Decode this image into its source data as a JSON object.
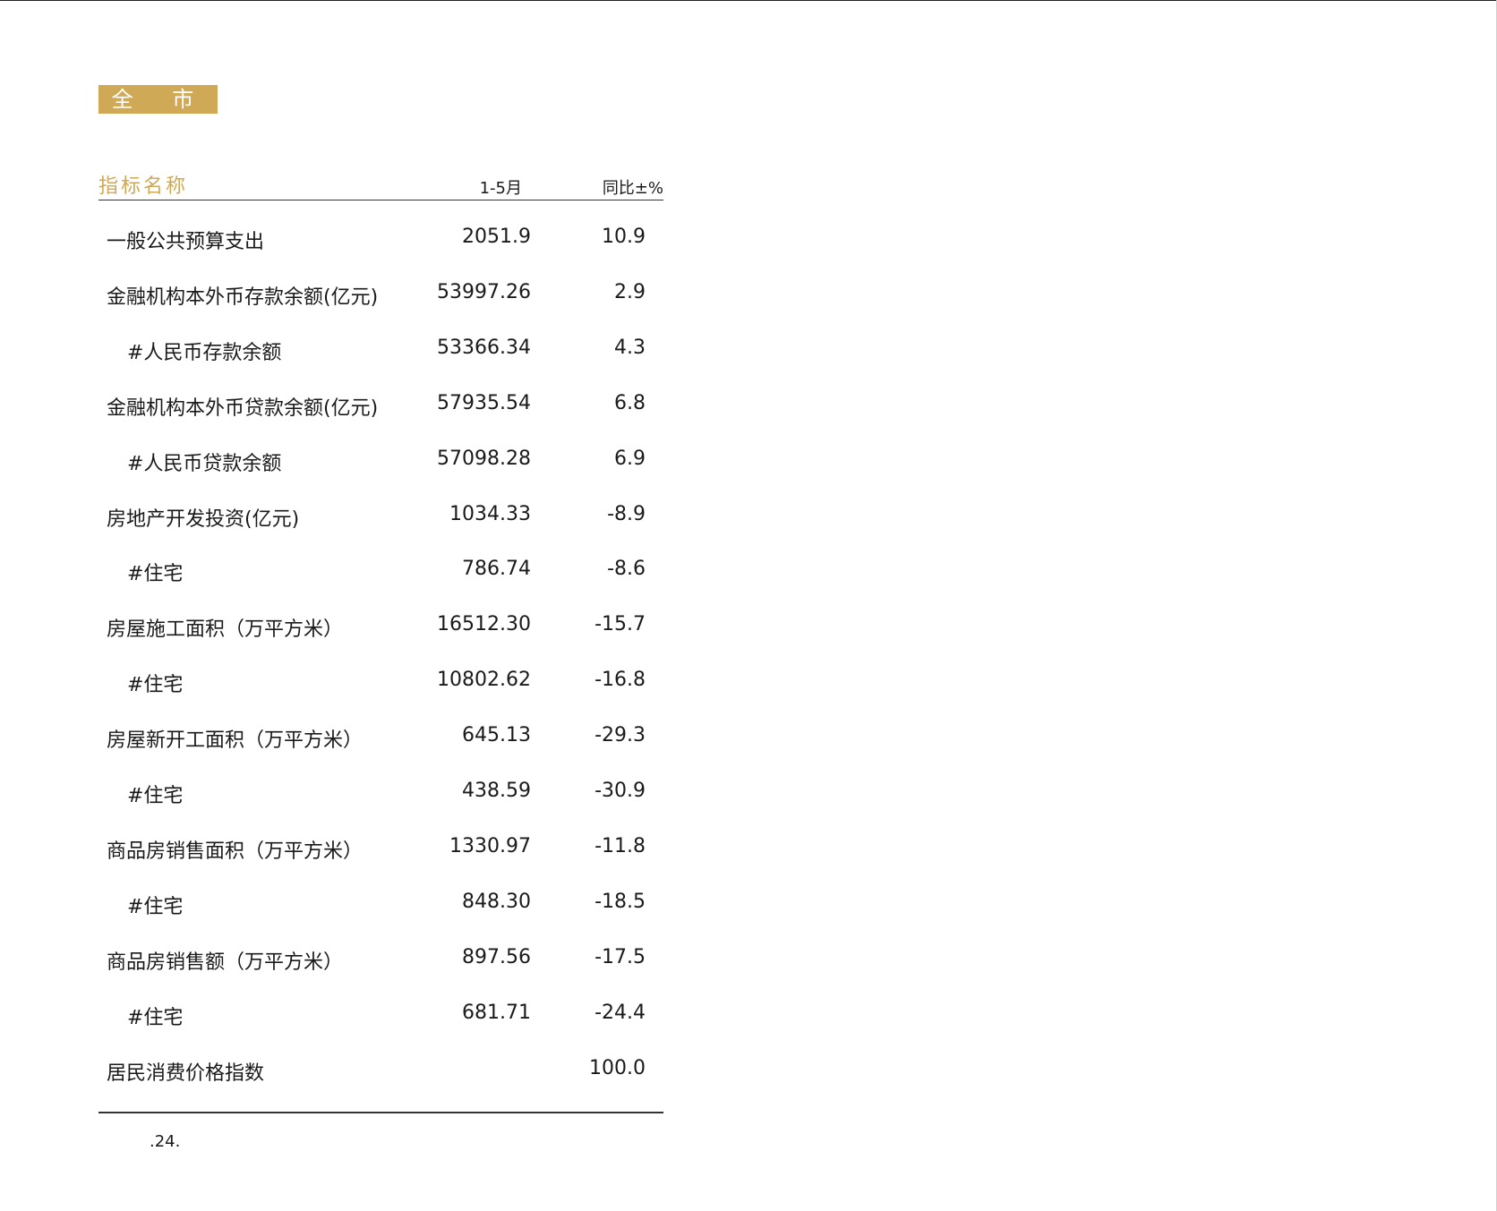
{
  "section_title": "全 市",
  "table": {
    "headers": {
      "name": "指标名称",
      "value": "1-5月",
      "yoy": "同比±%"
    },
    "rows": [
      {
        "name": "一般公共预算支出",
        "value": "2051.9",
        "yoy": "10.9",
        "sub": false
      },
      {
        "name": "金融机构本外币存款余额(亿元)",
        "value": "53997.26",
        "yoy": "2.9",
        "sub": false
      },
      {
        "name": "#人民币存款余额",
        "value": "53366.34",
        "yoy": "4.3",
        "sub": true
      },
      {
        "name": "金融机构本外币贷款余额(亿元)",
        "value": "57935.54",
        "yoy": "6.8",
        "sub": false
      },
      {
        "name": "#人民币贷款余额",
        "value": "57098.28",
        "yoy": "6.9",
        "sub": true
      },
      {
        "name": "房地产开发投资(亿元)",
        "value": "1034.33",
        "yoy": "-8.9",
        "sub": false
      },
      {
        "name": "#住宅",
        "value": "786.74",
        "yoy": "-8.6",
        "sub": true
      },
      {
        "name": "房屋施工面积（万平方米）",
        "value": "16512.30",
        "yoy": "-15.7",
        "sub": false
      },
      {
        "name": "#住宅",
        "value": "10802.62",
        "yoy": "-16.8",
        "sub": true
      },
      {
        "name": "房屋新开工面积（万平方米）",
        "value": "645.13",
        "yoy": "-29.3",
        "sub": false
      },
      {
        "name": "#住宅",
        "value": "438.59",
        "yoy": "-30.9",
        "sub": true
      },
      {
        "name": "商品房销售面积（万平方米）",
        "value": "1330.97",
        "yoy": "-11.8",
        "sub": false
      },
      {
        "name": "#住宅",
        "value": "848.30",
        "yoy": "-18.5",
        "sub": true
      },
      {
        "name": "商品房销售额（万平方米）",
        "value": "897.56",
        "yoy": "-17.5",
        "sub": false
      },
      {
        "name": "#住宅",
        "value": "681.71",
        "yoy": "-24.4",
        "sub": true
      },
      {
        "name": "居民消费价格指数",
        "value": "",
        "yoy": "100.0",
        "sub": false
      }
    ]
  },
  "footnote": ".24."
}
